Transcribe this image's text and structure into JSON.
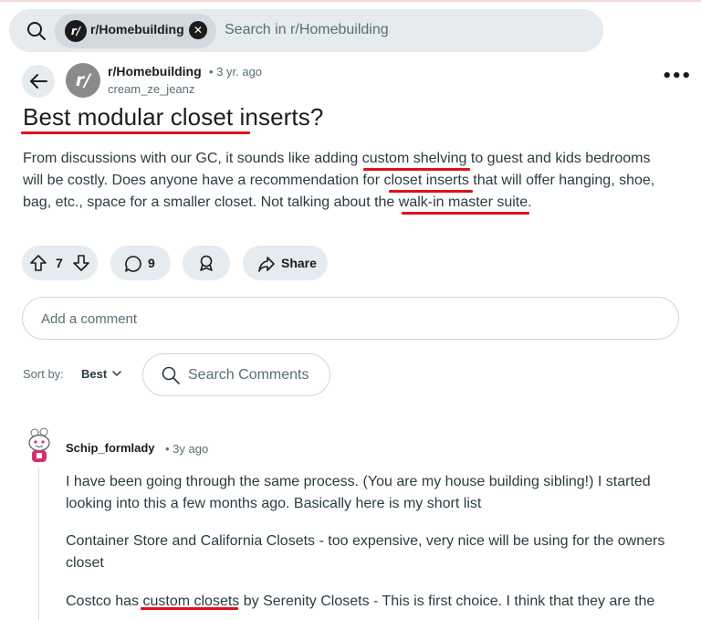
{
  "search": {
    "chip_label": "r/Homebuilding",
    "chip_avatar_text": "r/",
    "placeholder": "Search in r/Homebuilding"
  },
  "post": {
    "subreddit": "r/Homebuilding",
    "age": "• 3 yr. ago",
    "author": "cream_ze_jeanz",
    "avatar_text": "r/",
    "title": "Best modular closet inserts?",
    "body_lines": [
      "From discussions with our GC, it sounds like adding custom shelving to guest and kids bedrooms",
      "will be costly. Does anyone have a recommendation for closet inserts that will offer hanging, shoe,",
      "bag, etc., space for a smaller closet. Not talking about the walk-in master suite."
    ],
    "votes": "7",
    "comments": "9",
    "share_label": "Share"
  },
  "comment_box": {
    "placeholder": "Add a comment"
  },
  "sort": {
    "label": "Sort by:",
    "value": "Best",
    "search_placeholder": "Search Comments"
  },
  "comment": {
    "user": "Schip_formlady",
    "age": "• 3y ago",
    "lines": [
      "I have been going through the same process. (You are my house building sibling!) I started",
      "looking into this a few months ago. Basically here is my short list",
      "Container Store and California Closets - too expensive, very nice will be using for the owners",
      "closet",
      "Costco has custom closets by Serenity Closets - This is first choice. I think that they are the"
    ]
  },
  "colors": {
    "accent_underline": "#e0101b",
    "pill_bg": "#e5ebee",
    "text_muted": "#576f76"
  },
  "icons": [
    "search-icon",
    "close-icon",
    "back-arrow-icon",
    "more-icon",
    "upvote-icon",
    "downvote-icon",
    "comment-icon",
    "award-icon",
    "share-icon",
    "chevron-down-icon",
    "search-comments-icon"
  ]
}
